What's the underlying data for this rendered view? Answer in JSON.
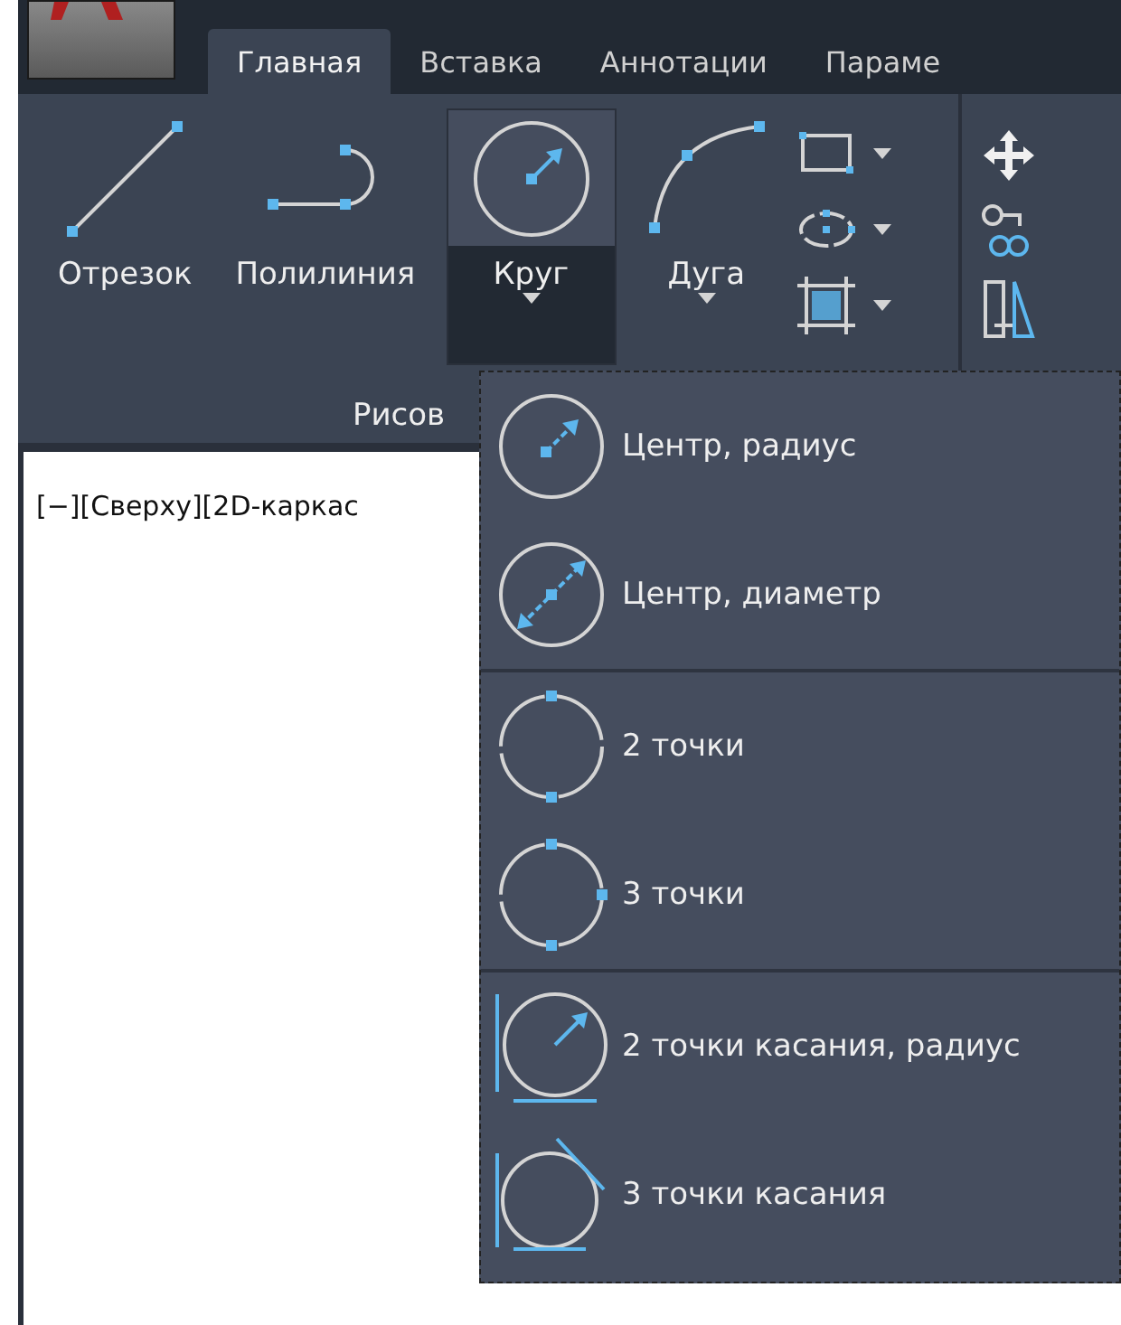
{
  "tabs": [
    {
      "label": "Главная",
      "selected": true
    },
    {
      "label": "Вставка",
      "selected": false
    },
    {
      "label": "Аннотации",
      "selected": false
    },
    {
      "label": "Параме",
      "selected": false
    }
  ],
  "draw_panel": {
    "large_tools": [
      {
        "kind": "line",
        "label": "Отрезок",
        "expanded": false,
        "dropdown": false
      },
      {
        "kind": "polyline",
        "label": "Полилиния",
        "expanded": false,
        "dropdown": false
      },
      {
        "kind": "circle",
        "label": "Круг",
        "expanded": true,
        "dropdown": true
      },
      {
        "kind": "arc",
        "label": "Дуга",
        "expanded": false,
        "dropdown": true
      }
    ],
    "small_tools": [
      {
        "kind": "rectangle"
      },
      {
        "kind": "ellipse"
      },
      {
        "kind": "hatch"
      }
    ],
    "title": "Рисов"
  },
  "modify_tools": [
    {
      "kind": "move"
    },
    {
      "kind": "copy"
    },
    {
      "kind": "mirror"
    }
  ],
  "viewport_label": "[−][Сверху][2D-каркас",
  "circle_menu": {
    "groups": [
      [
        {
          "kind": "center-radius",
          "label": "Центр, радиус"
        },
        {
          "kind": "center-diameter",
          "label": "Центр, диаметр"
        }
      ],
      [
        {
          "kind": "two-point",
          "label": "2 точки"
        },
        {
          "kind": "three-point",
          "label": "3 точки"
        }
      ],
      [
        {
          "kind": "tan-tan-radius",
          "label": "2 точки касания, радиус"
        },
        {
          "kind": "tan-tan-tan",
          "label": "3 точки касания"
        }
      ]
    ]
  }
}
